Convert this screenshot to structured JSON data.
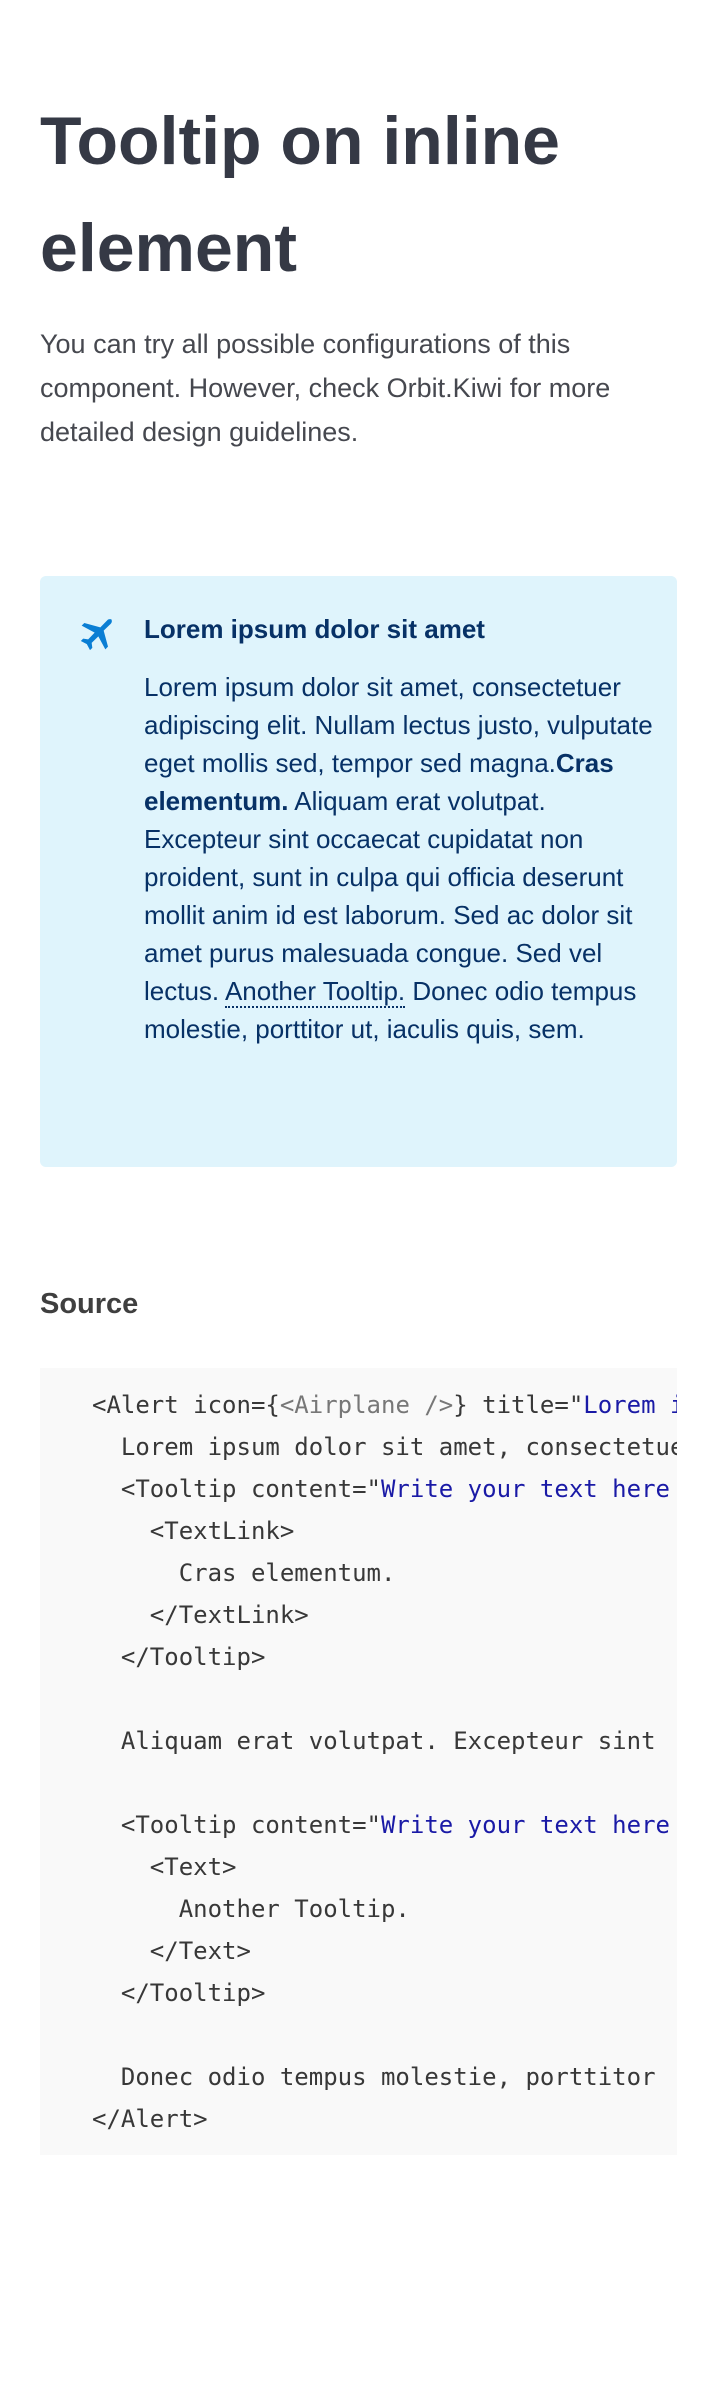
{
  "page": {
    "title": "Tooltip on inline element",
    "intro": "You can try all possible configurations of this component. However, check Orbit.Kiwi for more detailed design guidelines."
  },
  "alert": {
    "icon": "airplane-icon",
    "title": "Lorem ipsum dolor sit amet",
    "body_part1": "Lorem ipsum dolor sit amet, consectetuer adipiscing elit. Nullam lectus justo, vulputate eget mollis sed, tempor sed magna.",
    "tooltip1_link": "Cras elementum.",
    "body_part2": " Aliquam erat volutpat. Excepteur sint occaecat cupidatat non proident, sunt in culpa qui officia deserunt mollit anim id est laborum. Sed ac dolor sit amet purus malesuada congue. Sed vel lectus. ",
    "tooltip2_text": "Another Tooltip.",
    "body_part3": " Donec odio tempus molestie, porttitor ut, iaculis quis, sem.",
    "background": "#dff4fc",
    "text_color": "#073166",
    "icon_color": "#0a7ed4"
  },
  "source": {
    "heading": "Source",
    "lines": {
      "l1a": "<Alert icon={",
      "l1b": "<Airplane />",
      "l1c": "} title=\"",
      "l1d": "Lorem ipsum dolor sit amet\">",
      "l2": "  Lorem ipsum dolor sit amet, consectetuer adipiscing elit.",
      "l3a": "  <Tooltip content=\"",
      "l3b": "Write your text here",
      "l4": "    <TextLink>",
      "l5": "      Cras elementum.",
      "l6": "    </TextLink>",
      "l7": "  </Tooltip>",
      "l8": "",
      "l9": "  Aliquam erat volutpat. Excepteur sint",
      "l10": "",
      "l11a": "  <Tooltip content=\"",
      "l11b": "Write your text here",
      "l12": "    <Text>",
      "l13": "      Another Tooltip.",
      "l14": "    </Text>",
      "l15": "  </Tooltip>",
      "l16": "",
      "l17": "  Donec odio tempus molestie, porttitor",
      "l18": "</Alert>"
    }
  }
}
